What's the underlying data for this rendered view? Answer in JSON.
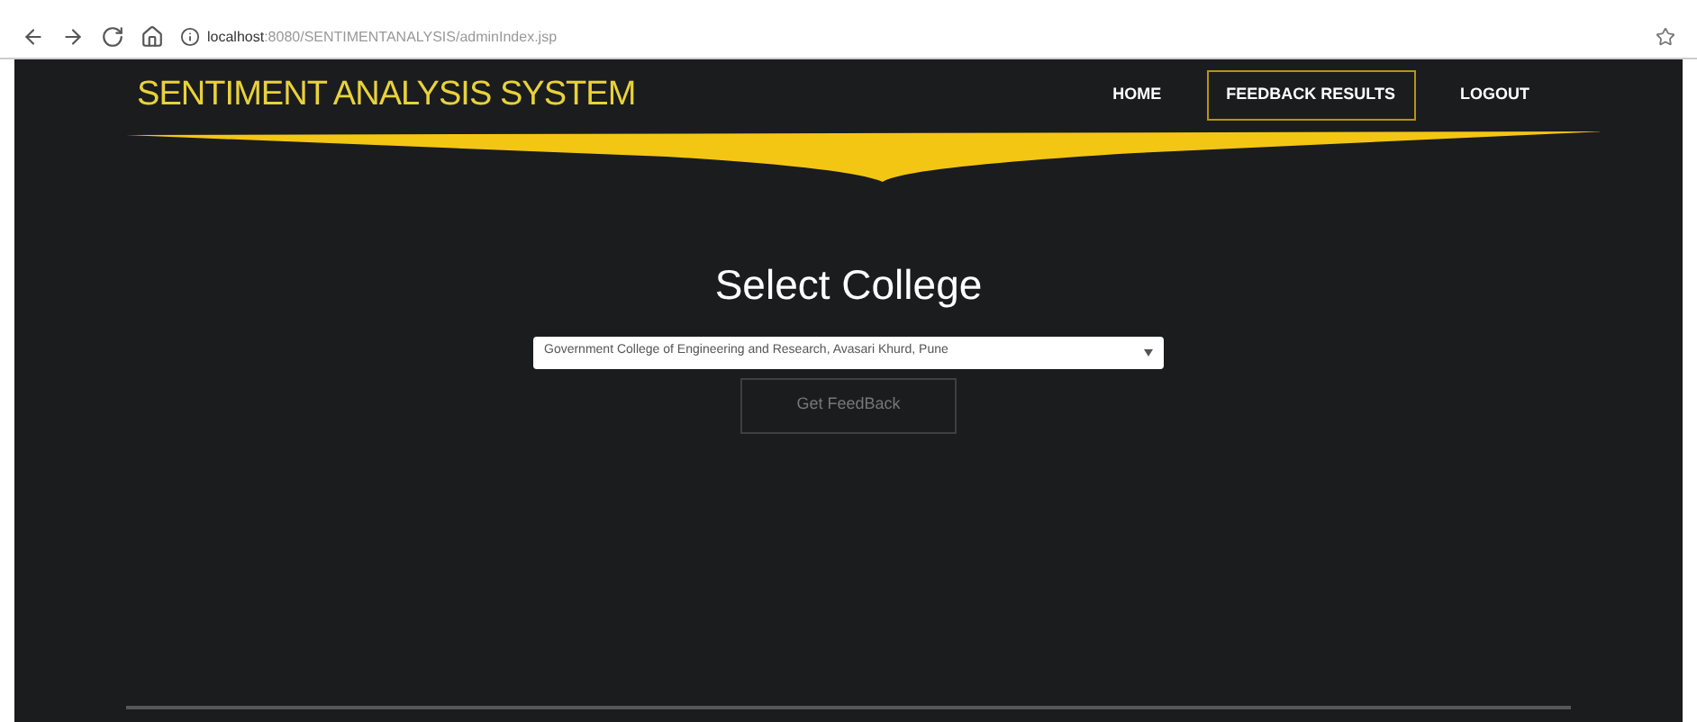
{
  "browser": {
    "url_host": "localhost",
    "url_path": ":8080/SENTIMENTANALYSIS/adminIndex.jsp"
  },
  "header": {
    "title": "SENTIMENT ANALYSIS SYSTEM",
    "nav": [
      {
        "label": "HOME",
        "selected": false
      },
      {
        "label": "FEEDBACK RESULTS",
        "selected": true
      },
      {
        "label": "LOGOUT",
        "selected": false
      }
    ]
  },
  "main": {
    "heading": "Select College",
    "college_select": {
      "value": "Government College of Engineering and Research, Avasari Khurd, Pune"
    },
    "submit_button": "Get FeedBack"
  }
}
